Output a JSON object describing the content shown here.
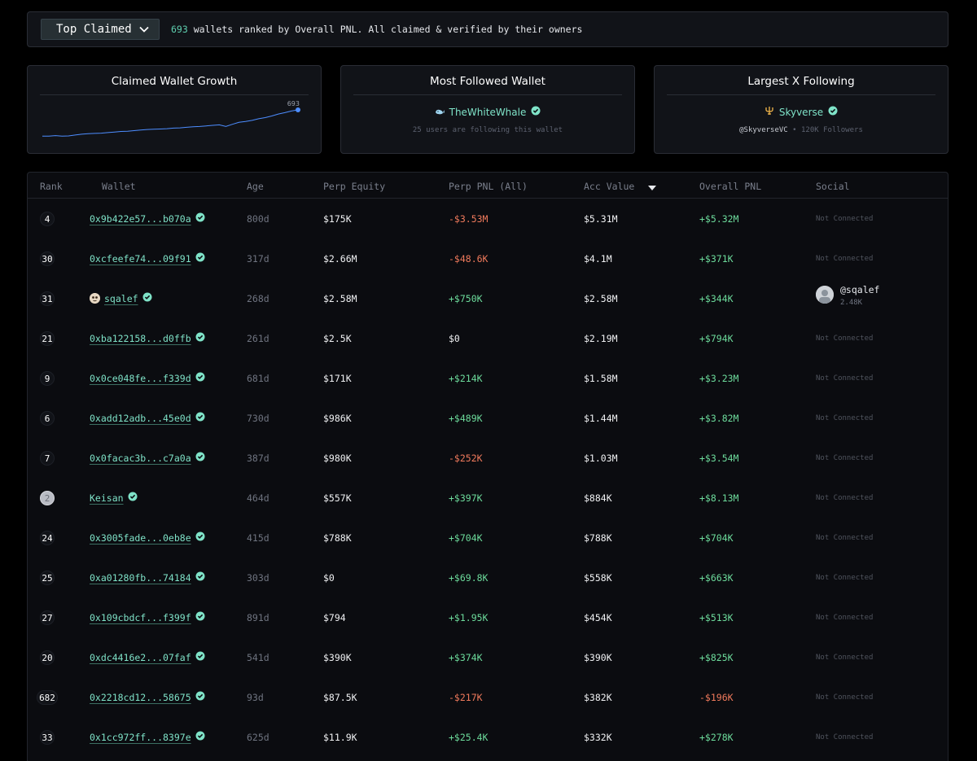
{
  "topbar": {
    "filter_label": "Top Claimed",
    "wallet_count": "693",
    "description": " wallets ranked by Overall PNL. All claimed & verified by their owners"
  },
  "cards": {
    "growth": {
      "title": "Claimed Wallet Growth",
      "end_label": "693",
      "series": [
        0.05,
        0.05,
        0.07,
        0.05,
        0.06,
        0.09,
        0.12,
        0.14,
        0.15,
        0.16,
        0.18,
        0.2,
        0.22,
        0.23,
        0.25,
        0.27,
        0.29,
        0.3,
        0.31,
        0.32,
        0.34,
        0.35,
        0.37,
        0.39,
        0.4,
        0.42,
        0.44,
        0.46,
        0.4,
        0.48,
        0.55,
        0.58,
        0.62,
        0.68,
        0.72,
        0.78,
        0.85,
        0.9,
        0.96,
        1.0
      ],
      "line_color": "#4d8dff"
    },
    "most_followed": {
      "title": "Most Followed Wallet",
      "name": "TheWhiteWhale",
      "subtext": "25 users are following this wallet"
    },
    "largest_x": {
      "title": "Largest X Following",
      "name": "Skyverse",
      "handle": "@SkyverseVC",
      "separator": " • ",
      "followers": "120K Followers"
    }
  },
  "table": {
    "headers": {
      "rank": "Rank",
      "wallet": "Wallet",
      "age": "Age",
      "perp_equity": "Perp Equity",
      "perp_pnl": "Perp PNL (All)",
      "acc_value": "Acc Value",
      "overall_pnl": "Overall PNL",
      "social": "Social"
    },
    "rows": [
      {
        "rank": "4",
        "wallet": "0x9b422e57...b070a",
        "age": "800d",
        "equity": "$175K",
        "perp": "-$3.53M",
        "perp_sign": "neg",
        "acc": "$5.31M",
        "overall": "+$5.32M",
        "overall_sign": "pos",
        "social": "Not Connected"
      },
      {
        "rank": "30",
        "wallet": "0xcfeefe74...09f91",
        "age": "317d",
        "equity": "$2.66M",
        "perp": "-$48.6K",
        "perp_sign": "neg",
        "acc": "$4.1M",
        "overall": "+$371K",
        "overall_sign": "pos",
        "social": "Not Connected"
      },
      {
        "rank": "31",
        "wallet": "sqalef",
        "wallet_avatar": true,
        "age": "268d",
        "equity": "$2.58M",
        "perp": "+$750K",
        "perp_sign": "pos",
        "acc": "$2.58M",
        "overall": "+$344K",
        "overall_sign": "pos",
        "social_handle": "@sqalef",
        "social_followers": "2.48K"
      },
      {
        "rank": "21",
        "wallet": "0xba122158...d0ffb",
        "age": "261d",
        "equity": "$2.5K",
        "perp": "$0",
        "perp_sign": "zero",
        "acc": "$2.19M",
        "overall": "+$794K",
        "overall_sign": "pos",
        "social": "Not Connected"
      },
      {
        "rank": "9",
        "wallet": "0x0ce048fe...f339d",
        "age": "681d",
        "equity": "$171K",
        "perp": "+$214K",
        "perp_sign": "pos",
        "acc": "$1.58M",
        "overall": "+$3.23M",
        "overall_sign": "pos",
        "social": "Not Connected"
      },
      {
        "rank": "6",
        "wallet": "0xadd12adb...45e0d",
        "age": "730d",
        "equity": "$986K",
        "perp": "+$489K",
        "perp_sign": "pos",
        "acc": "$1.44M",
        "overall": "+$3.82M",
        "overall_sign": "pos",
        "social": "Not Connected"
      },
      {
        "rank": "7",
        "wallet": "0x0facac3b...c7a0a",
        "age": "387d",
        "equity": "$980K",
        "perp": "-$252K",
        "perp_sign": "neg",
        "acc": "$1.03M",
        "overall": "+$3.54M",
        "overall_sign": "pos",
        "social": "Not Connected"
      },
      {
        "rank": "2",
        "rank_style": "silver",
        "wallet": "Keisan",
        "age": "464d",
        "equity": "$557K",
        "perp": "+$397K",
        "perp_sign": "pos",
        "acc": "$884K",
        "overall": "+$8.13M",
        "overall_sign": "pos",
        "social": "Not Connected"
      },
      {
        "rank": "24",
        "wallet": "0x3005fade...0eb8e",
        "age": "415d",
        "equity": "$788K",
        "perp": "+$704K",
        "perp_sign": "pos",
        "acc": "$788K",
        "overall": "+$704K",
        "overall_sign": "pos",
        "social": "Not Connected"
      },
      {
        "rank": "25",
        "wallet": "0xa01280fb...74184",
        "age": "303d",
        "equity": "$0",
        "perp": "+$69.8K",
        "perp_sign": "pos",
        "acc": "$558K",
        "overall": "+$663K",
        "overall_sign": "pos",
        "social": "Not Connected"
      },
      {
        "rank": "27",
        "wallet": "0x109cbdcf...f399f",
        "age": "891d",
        "equity": "$794",
        "perp": "+$1.95K",
        "perp_sign": "pos",
        "acc": "$454K",
        "overall": "+$513K",
        "overall_sign": "pos",
        "social": "Not Connected"
      },
      {
        "rank": "20",
        "wallet": "0xdc4416e2...07faf",
        "age": "541d",
        "equity": "$390K",
        "perp": "+$374K",
        "perp_sign": "pos",
        "acc": "$390K",
        "overall": "+$825K",
        "overall_sign": "pos",
        "social": "Not Connected"
      },
      {
        "rank": "682",
        "wallet": "0x2218cd12...58675",
        "age": "93d",
        "equity": "$87.5K",
        "perp": "-$217K",
        "perp_sign": "neg",
        "acc": "$382K",
        "overall": "-$196K",
        "overall_sign": "neg",
        "social": "Not Connected"
      },
      {
        "rank": "33",
        "wallet": "0x1cc972ff...8397e",
        "age": "625d",
        "equity": "$11.9K",
        "perp": "+$25.4K",
        "perp_sign": "pos",
        "acc": "$332K",
        "overall": "+$278K",
        "overall_sign": "pos",
        "social": "Not Connected"
      }
    ]
  }
}
